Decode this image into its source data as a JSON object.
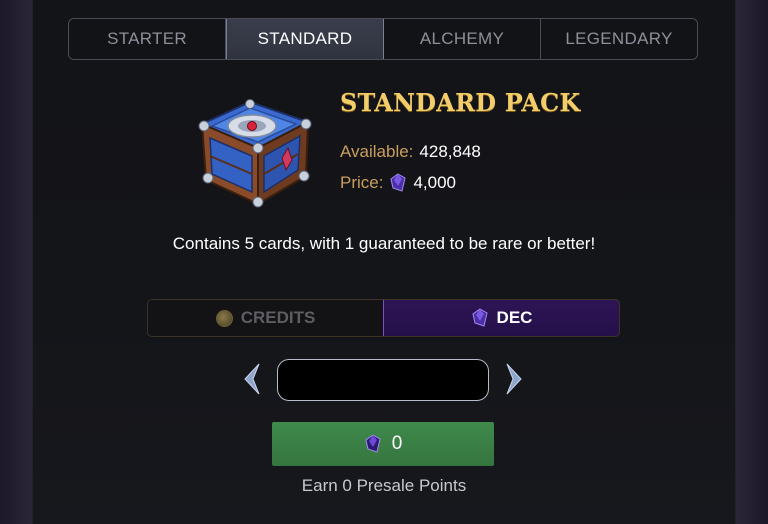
{
  "tabs": [
    {
      "label": "STARTER",
      "active": false
    },
    {
      "label": "STANDARD",
      "active": true
    },
    {
      "label": "ALCHEMY",
      "active": false
    },
    {
      "label": "LEGENDARY",
      "active": false
    }
  ],
  "pack": {
    "title": "STANDARD PACK",
    "available_label": "Available:",
    "available_value": "428,848",
    "price_label": "Price:",
    "price_value": "4,000",
    "description": "Contains 5 cards, with 1 guaranteed to be rare or better!"
  },
  "currency": {
    "credits_label": "CREDITS",
    "dec_label": "DEC",
    "selected": "DEC"
  },
  "quantity": {
    "value": "",
    "placeholder": ""
  },
  "buy": {
    "total": "0"
  },
  "earn_text": "Earn 0 Presale Points",
  "colors": {
    "title_gold": "#f2cd6a",
    "label_tan": "#c99e5d",
    "buy_green": "#3f8a4c",
    "dec_purple": "#2e1455"
  },
  "icons": {
    "chest": "standard-pack-chest-icon",
    "dec": "dec-gem-icon",
    "credits": "credits-coin-icon",
    "prev": "chevron-left-icon",
    "next": "chevron-right-icon"
  }
}
